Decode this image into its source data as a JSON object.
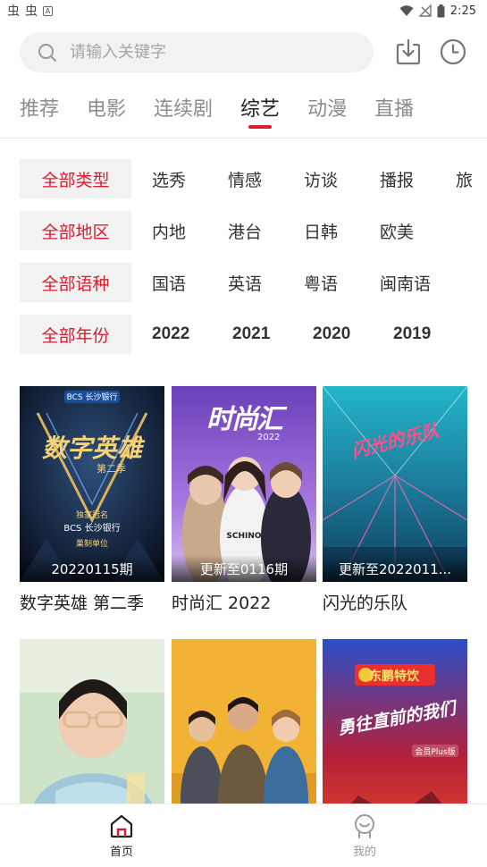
{
  "status_bar": {
    "left_glyphs": [
      "虫",
      "虫"
    ],
    "left_badge": "A",
    "time": "2:25"
  },
  "search": {
    "placeholder": "请输入关键字"
  },
  "tabs": [
    {
      "label": "推荐"
    },
    {
      "label": "电影"
    },
    {
      "label": "连续剧"
    },
    {
      "label": "综艺"
    },
    {
      "label": "动漫"
    },
    {
      "label": "直播"
    }
  ],
  "active_tab": "综艺",
  "filters": {
    "type": {
      "head": "全部类型",
      "options": [
        "选秀",
        "情感",
        "访谈",
        "播报",
        "旅"
      ]
    },
    "region": {
      "head": "全部地区",
      "options": [
        "内地",
        "港台",
        "日韩",
        "欧美"
      ]
    },
    "language": {
      "head": "全部语种",
      "options": [
        "国语",
        "英语",
        "粤语",
        "闽南语"
      ]
    },
    "year": {
      "head": "全部年份",
      "options": [
        "2022",
        "2021",
        "2020",
        "2019"
      ]
    }
  },
  "cards": [
    {
      "title": "数字英雄 第二季",
      "badge": "20220115期",
      "poster_text": "数字英雄",
      "poster_sub": "第二季",
      "poster_brand": "BCS 长沙银行",
      "poster_note1": "独家冠名",
      "poster_note2": "巢制单位"
    },
    {
      "title": "时尚汇 2022",
      "badge": "更新至0116期",
      "poster_text": "时尚汇",
      "poster_sub": "2022"
    },
    {
      "title": "闪光的乐队",
      "badge": "更新至2022011...",
      "poster_text": "闪光的乐队"
    },
    {
      "title": "",
      "badge": ""
    },
    {
      "title": "",
      "badge": ""
    },
    {
      "title": "",
      "badge": "",
      "poster_brand": "东鹏特饮",
      "poster_text": "勇往直前的我们",
      "poster_sub": "会员Plus版"
    }
  ],
  "bottom_nav": [
    {
      "label": "首页",
      "active": true
    },
    {
      "label": "我的",
      "active": false
    }
  ],
  "colors": {
    "accent": "#d81e2f",
    "filter_bg": "#f2f2f2",
    "search_bg": "#f2f2f2"
  }
}
